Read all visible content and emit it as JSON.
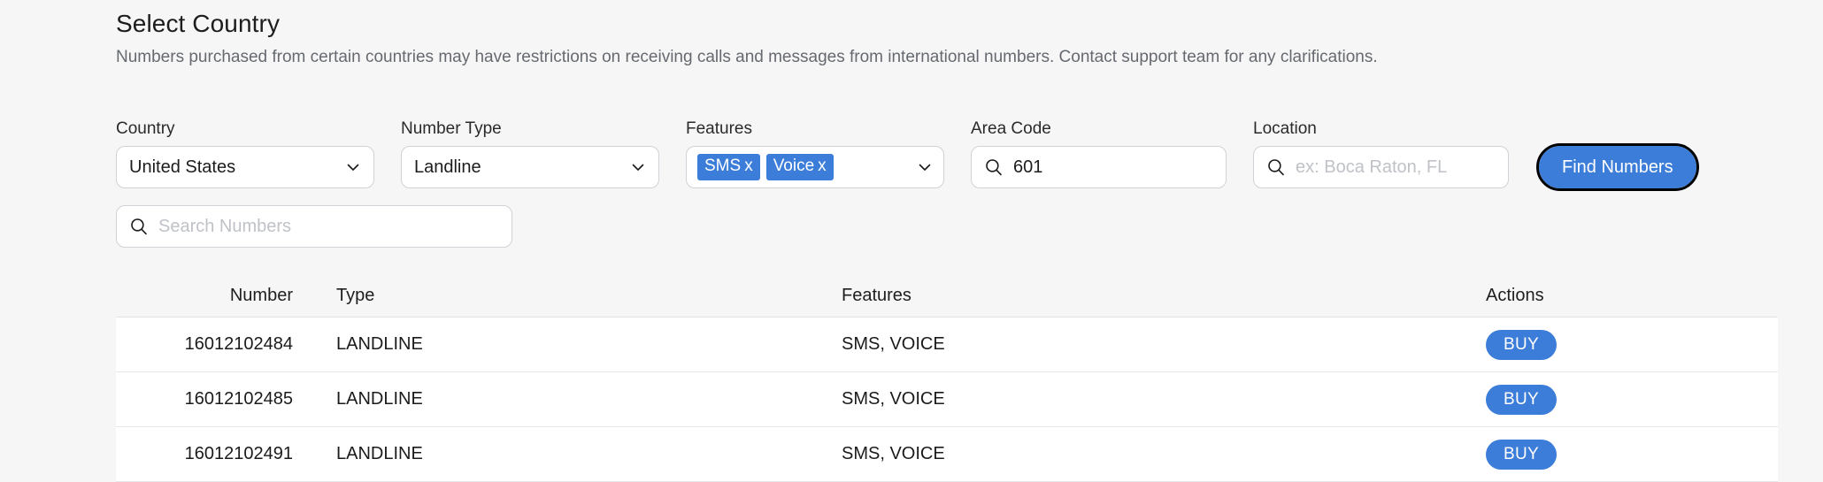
{
  "header": {
    "title": "Select Country",
    "subtitle": "Numbers purchased from certain countries may have restrictions on receiving calls and messages from international numbers. Contact support team for any clarifications."
  },
  "filters": {
    "country": {
      "label": "Country",
      "value": "United States"
    },
    "number_type": {
      "label": "Number Type",
      "value": "Landline"
    },
    "features": {
      "label": "Features",
      "tags": [
        {
          "label": "SMS",
          "remove": "x"
        },
        {
          "label": "Voice",
          "remove": "x"
        }
      ]
    },
    "area_code": {
      "label": "Area Code",
      "value": "601",
      "icon": "search-icon"
    },
    "location": {
      "label": "Location",
      "value": "",
      "placeholder": "ex: Boca Raton, FL",
      "icon": "search-icon"
    },
    "find_button": "Find Numbers"
  },
  "search": {
    "value": "",
    "placeholder": "Search Numbers",
    "icon": "search-icon"
  },
  "table": {
    "columns": [
      "Number",
      "Type",
      "Features",
      "Actions"
    ],
    "rows": [
      {
        "number": "16012102484",
        "type": "LANDLINE",
        "features": "SMS, VOICE",
        "action": "BUY"
      },
      {
        "number": "16012102485",
        "type": "LANDLINE",
        "features": "SMS, VOICE",
        "action": "BUY"
      },
      {
        "number": "16012102491",
        "type": "LANDLINE",
        "features": "SMS, VOICE",
        "action": "BUY"
      }
    ]
  },
  "colors": {
    "accent": "#3b7dd8",
    "page_bg": "#f6f6f6",
    "row_bg": "#ffffff",
    "focus_ring": "#000000"
  }
}
